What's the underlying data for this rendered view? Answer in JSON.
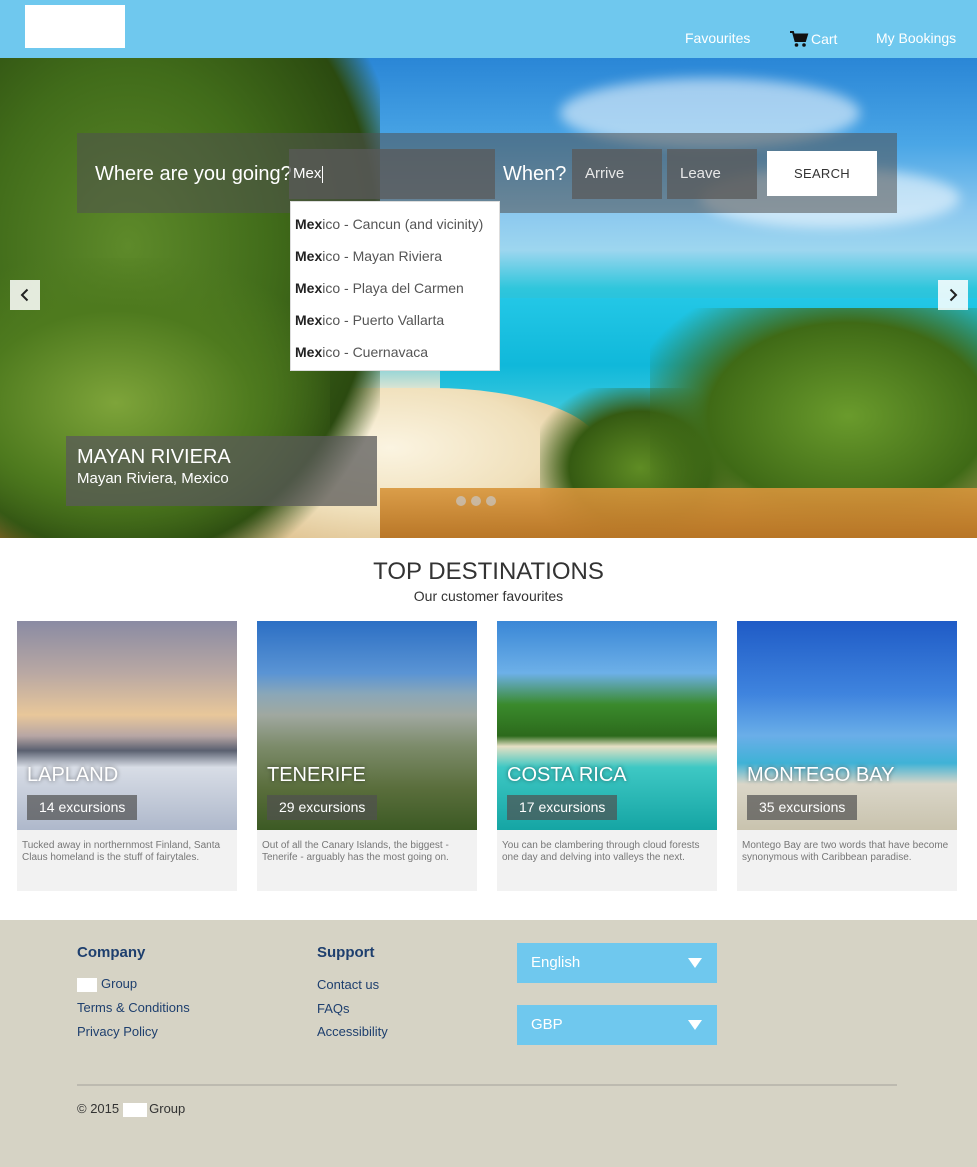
{
  "header": {
    "nav": {
      "favourites": "Favourites",
      "cart": "Cart",
      "bookings": "My Bookings"
    }
  },
  "search": {
    "where_label": "Where are you going?",
    "where_value": "Mex",
    "when_label": "When?",
    "arrive_placeholder": "Arrive",
    "leave_placeholder": "Leave",
    "button_label": "SEARCH"
  },
  "autocomplete": [
    {
      "match": "Mex",
      "rest": "ico - Cancun (and vicinity)"
    },
    {
      "match": "Mex",
      "rest": "ico - Mayan Riviera"
    },
    {
      "match": "Mex",
      "rest": "ico - Playa del Carmen"
    },
    {
      "match": "Mex",
      "rest": "ico - Puerto Vallarta"
    },
    {
      "match": "Mex",
      "rest": "ico - Cuernavaca"
    }
  ],
  "hero": {
    "caption_title": "MAYAN RIVIERA",
    "caption_subtitle": "Mayan Riviera, Mexico",
    "slide_count": 3
  },
  "top_destinations": {
    "title": "TOP DESTINATIONS",
    "subtitle": "Our customer favourites",
    "cards": [
      {
        "name": "LAPLAND",
        "count": "14 excursions",
        "desc": "Tucked away in northernmost Finland, Santa Claus homeland is the stuff of fairytales."
      },
      {
        "name": "TENERIFE",
        "count": "29 excursions",
        "desc": "Out of all the Canary Islands, the biggest - Tenerife - arguably has the most going on."
      },
      {
        "name": "COSTA RICA",
        "count": "17 excursions",
        "desc": "You can be clambering through cloud forests one day and delving into valleys the next."
      },
      {
        "name": "MONTEGO BAY",
        "count": "35 excursions",
        "desc": "Montego Bay are two words that have become synonymous with Caribbean paradise."
      }
    ]
  },
  "footer": {
    "company_title": "Company",
    "company_links": [
      "Group",
      "Terms & Conditions",
      "Privacy Policy"
    ],
    "support_title": "Support",
    "support_links": [
      "Contact us",
      "FAQs",
      "Accessibility"
    ],
    "language": "English",
    "currency": "GBP",
    "copyright_prefix": "© 2015",
    "copyright_suffix": "Group"
  },
  "colors": {
    "header_bg": "#6fc8ee",
    "footer_bg": "#d6d3c5",
    "link_color": "#1e3f6e"
  }
}
